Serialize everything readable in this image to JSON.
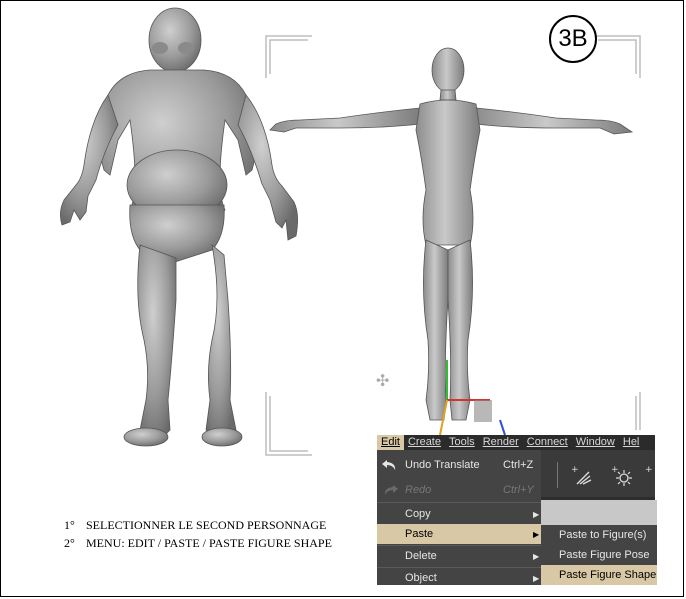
{
  "badge": {
    "text": "3B"
  },
  "instructions": [
    {
      "num": "1°",
      "text": "SELECTIONNER LE SECOND PERSONNAGE"
    },
    {
      "num": "2°",
      "text": "MENU: EDIT / PASTE / PASTE FIGURE SHAPE"
    }
  ],
  "menubar": {
    "items": [
      {
        "label": "Edit",
        "active": true
      },
      {
        "label": "Create"
      },
      {
        "label": "Tools"
      },
      {
        "label": "Render"
      },
      {
        "label": "Connect"
      },
      {
        "label": "Window"
      },
      {
        "label": "Hel"
      }
    ]
  },
  "edit_menu": {
    "undo": {
      "label": "Undo Translate",
      "shortcut": "Ctrl+Z",
      "icon": "undo-icon"
    },
    "redo": {
      "label": "Redo",
      "shortcut": "Ctrl+Y",
      "icon": "redo-icon",
      "disabled": true
    },
    "copy": {
      "label": "Copy"
    },
    "paste": {
      "label": "Paste",
      "highlighted": true
    },
    "delete": {
      "label": "Delete"
    },
    "object": {
      "label": "Object"
    }
  },
  "paste_submenu": {
    "items": [
      {
        "label": "Paste to Figure(s)"
      },
      {
        "label": "Paste Figure Pose"
      },
      {
        "label": "Paste Figure Shape",
        "highlighted": true
      }
    ]
  },
  "toolbar": {
    "icons": [
      "spotlight-icon",
      "point-light-icon",
      "add-light-icon"
    ]
  },
  "colors": {
    "highlight": "#d9c8a6",
    "menu_bg": "#444444",
    "menubar_bg": "#2b2b2b"
  }
}
